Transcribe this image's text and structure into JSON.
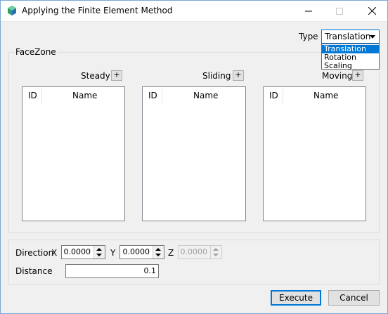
{
  "window": {
    "title": "Applying the Finite Element Method"
  },
  "type_selector": {
    "label": "Type",
    "selected": "Translation",
    "options": [
      "Translation",
      "Rotation",
      "Scaling"
    ]
  },
  "facezone": {
    "legend": "FaceZone",
    "columns": [
      {
        "label": "Steady",
        "add_label": "+",
        "headers": {
          "id": "ID",
          "name": "Name"
        }
      },
      {
        "label": "Sliding",
        "add_label": "+",
        "headers": {
          "id": "ID",
          "name": "Name"
        }
      },
      {
        "label": "Moving",
        "add_label": "+",
        "headers": {
          "id": "ID",
          "name": "Name"
        }
      }
    ]
  },
  "direction": {
    "label": "Direction",
    "x_label": "X",
    "x_value": "0.0000",
    "y_label": "Y",
    "y_value": "0.0000",
    "z_label": "Z",
    "z_value": "0.0000"
  },
  "distance": {
    "label": "Distance",
    "value": "0.1"
  },
  "buttons": {
    "execute": "Execute",
    "cancel": "Cancel"
  },
  "colors": {
    "accent": "#0078d7",
    "background": "#f0f0f0"
  }
}
